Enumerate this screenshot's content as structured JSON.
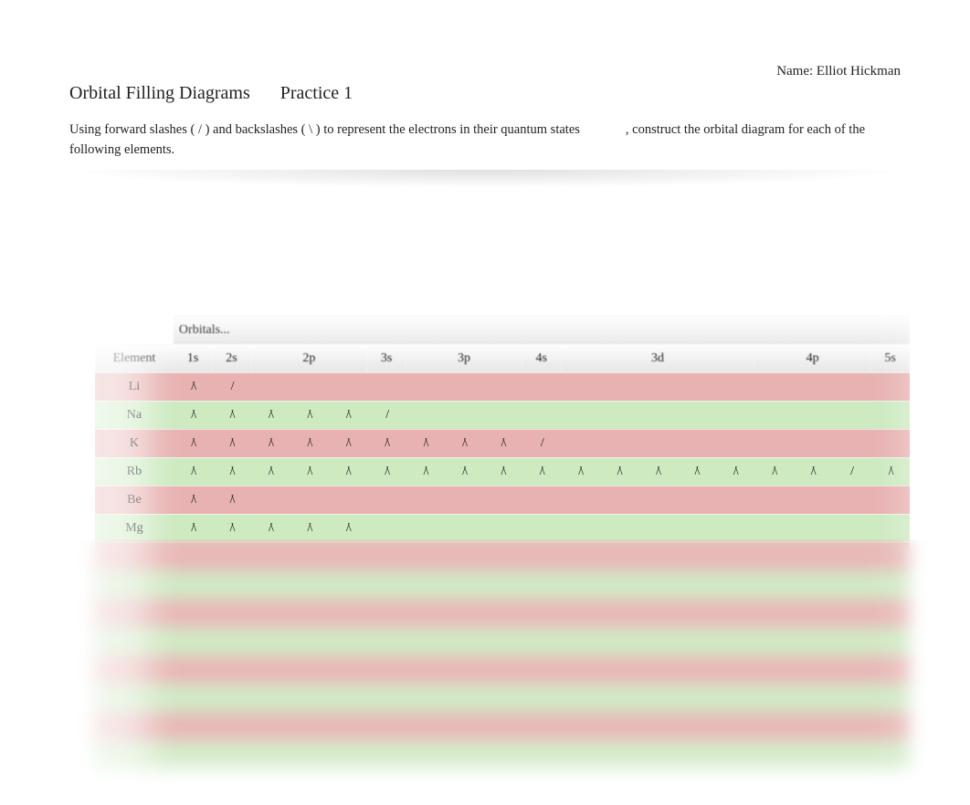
{
  "header": {
    "name_label": "Name:",
    "name_value": "Elliot Hickman",
    "title": "Orbital Filling Diagrams",
    "subtitle": "Practice 1"
  },
  "instructions": {
    "part1": "Using forward slashes ( / ) and backslashes ( \\ ) to represent the electrons in their quantum states",
    "part2": ", construct the orbital diagram for each of the following elements."
  },
  "table": {
    "orbitals_header": "Orbitals...",
    "columns": {
      "element": "Element",
      "groups": [
        {
          "label": "1s",
          "span": 1
        },
        {
          "label": "2s",
          "span": 1
        },
        {
          "label": "2p",
          "span": 3
        },
        {
          "label": "3s",
          "span": 1
        },
        {
          "label": "3p",
          "span": 3
        },
        {
          "label": "4s",
          "span": 1
        },
        {
          "label": "3d",
          "span": 5
        },
        {
          "label": "4p",
          "span": 3
        },
        {
          "label": "5s",
          "span": 1
        }
      ]
    },
    "rows": [
      {
        "color": "red",
        "element": "Li",
        "cells": [
          "/\\",
          "/",
          "",
          "",
          "",
          "",
          "",
          "",
          "",
          "",
          "",
          "",
          "",
          "",
          "",
          "",
          "",
          "",
          ""
        ]
      },
      {
        "color": "green",
        "element": "Na",
        "cells": [
          "/\\",
          "/\\",
          "/\\",
          "/\\",
          "/\\",
          "/",
          "",
          "",
          "",
          "",
          "",
          "",
          "",
          "",
          "",
          "",
          "",
          "",
          ""
        ]
      },
      {
        "color": "red",
        "element": "K",
        "cells": [
          "/\\",
          "/\\",
          "/\\",
          "/\\",
          "/\\",
          "/\\",
          "/\\",
          "/\\",
          "/\\",
          "/",
          "",
          "",
          "",
          "",
          "",
          "",
          "",
          "",
          ""
        ]
      },
      {
        "color": "green",
        "element": "Rb",
        "cells": [
          "/\\",
          "/\\",
          "/\\",
          "/\\",
          "/\\",
          "/\\",
          "/\\",
          "/\\",
          "/\\",
          "/\\",
          "/\\",
          "/\\",
          "/\\",
          "/\\",
          "/\\",
          "/\\",
          "/\\",
          "/",
          "/\\"
        ]
      },
      {
        "color": "red",
        "element": "Be",
        "cells": [
          "/\\",
          "/\\",
          "",
          "",
          "",
          "",
          "",
          "",
          "",
          "",
          "",
          "",
          "",
          "",
          "",
          "",
          "",
          "",
          ""
        ]
      },
      {
        "color": "green",
        "element": "Mg",
        "cells": [
          "/\\",
          "/\\",
          "/\\",
          "/\\",
          "/\\",
          "",
          "",
          "",
          "",
          "",
          "",
          "",
          "",
          "",
          "",
          "",
          "",
          "",
          ""
        ]
      },
      {
        "color": "red",
        "element": "",
        "cells": [
          "",
          "",
          "",
          "",
          "",
          "",
          "",
          "",
          "",
          "",
          "",
          "",
          "",
          "",
          "",
          "",
          "",
          "",
          ""
        ]
      },
      {
        "color": "green",
        "element": "",
        "cells": [
          "",
          "",
          "",
          "",
          "",
          "",
          "",
          "",
          "",
          "",
          "",
          "",
          "",
          "",
          "",
          "",
          "",
          "",
          ""
        ]
      },
      {
        "color": "red",
        "element": "",
        "cells": [
          "",
          "",
          "",
          "",
          "",
          "",
          "",
          "",
          "",
          "",
          "",
          "",
          "",
          "",
          "",
          "",
          "",
          "",
          ""
        ]
      },
      {
        "color": "green",
        "element": "",
        "cells": [
          "",
          "",
          "",
          "",
          "",
          "",
          "",
          "",
          "",
          "",
          "",
          "",
          "",
          "",
          "",
          "",
          "",
          "",
          ""
        ]
      },
      {
        "color": "red",
        "element": "",
        "cells": [
          "",
          "",
          "",
          "",
          "",
          "",
          "",
          "",
          "",
          "",
          "",
          "",
          "",
          "",
          "",
          "",
          "",
          "",
          ""
        ]
      },
      {
        "color": "green",
        "element": "",
        "cells": [
          "",
          "",
          "",
          "",
          "",
          "",
          "",
          "",
          "",
          "",
          "",
          "",
          "",
          "",
          "",
          "",
          "",
          "",
          ""
        ]
      },
      {
        "color": "red",
        "element": "",
        "cells": [
          "",
          "",
          "",
          "",
          "",
          "",
          "",
          "",
          "",
          "",
          "",
          "",
          "",
          "",
          "",
          "",
          "",
          "",
          ""
        ]
      },
      {
        "color": "green",
        "element": "",
        "cells": [
          "",
          "",
          "",
          "",
          "",
          "",
          "",
          "",
          "",
          "",
          "",
          "",
          "",
          "",
          "",
          "",
          "",
          "",
          ""
        ]
      }
    ]
  }
}
